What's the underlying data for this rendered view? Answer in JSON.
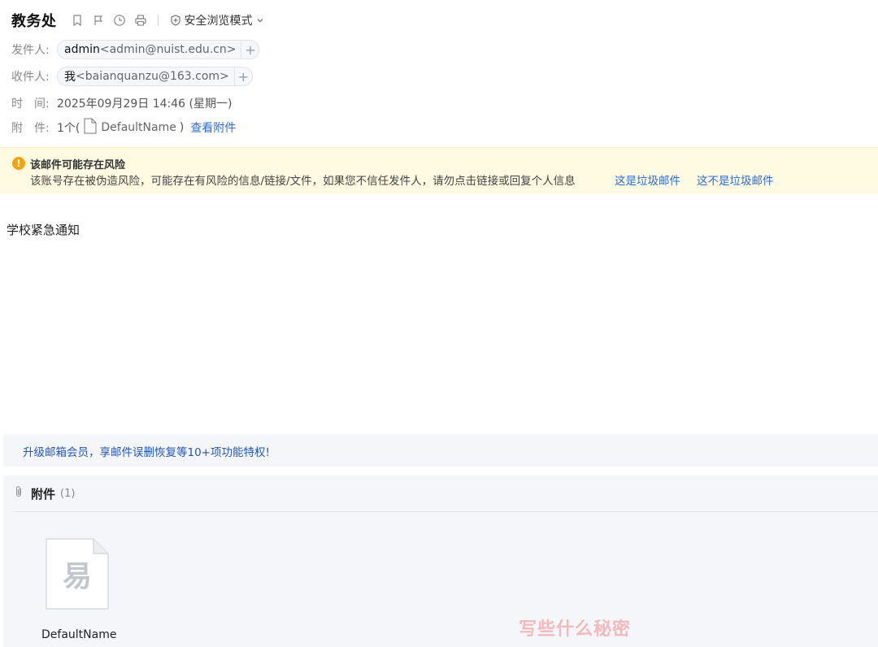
{
  "header": {
    "subject": "教务处",
    "safe_mode_label": "安全浏览模式"
  },
  "meta": {
    "from_label": "发件人:",
    "from_name": "admin",
    "from_addr": "<admin@nuist.edu.cn>",
    "to_label": "收件人:",
    "to_name": "我",
    "to_addr": "<baianquanzu@163.com>",
    "time_label": "时　间:",
    "time_value": "2025年09月29日 14:46 (星期一)",
    "attach_label": "附　件:",
    "attach_count": "1个(",
    "attach_name": "DefaultName",
    "attach_close": ")",
    "view_attach_link": "查看附件"
  },
  "warning": {
    "title": "该邮件可能存在风险",
    "text": "该账号存在被伪造风险，可能存在有风险的信息/链接/文件，如果您不信任发件人，请勿点击链接或回复个人信息",
    "spam_link": "这是垃圾邮件",
    "not_spam_link": "这不是垃圾邮件"
  },
  "body": {
    "text": "学校紧急通知"
  },
  "promo": {
    "text": "升级邮箱会员，享邮件误删恢复等10+项功能特权!"
  },
  "attachments": {
    "title": "附件",
    "count": "(1)",
    "files": [
      {
        "name": "DefaultName"
      }
    ]
  },
  "watermark": {
    "text": "写些什么秘密"
  },
  "colors": {
    "link": "#2b6dd9",
    "warning_bg": "#fffbe3",
    "warning_icon": "#f5a20a",
    "panel_bg": "#f4f6f9"
  }
}
